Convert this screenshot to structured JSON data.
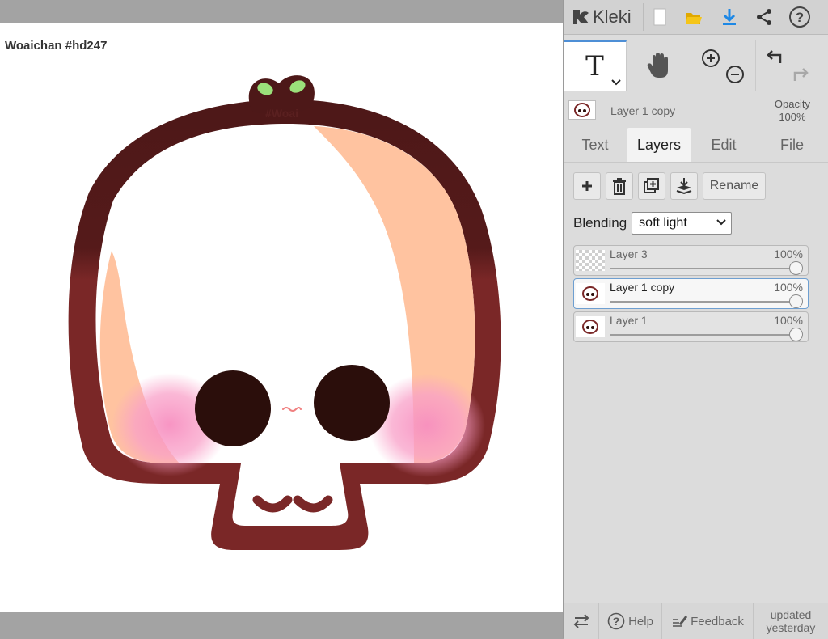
{
  "canvas": {
    "document_title": "Woaichan #hd247",
    "watermark": "#Woai"
  },
  "app": {
    "logo": "Kleki",
    "toolbar_icons": [
      "new-file-icon",
      "open-folder-icon",
      "download-icon",
      "share-icon",
      "help-icon"
    ]
  },
  "tools": {
    "active_tool_glyph": "T",
    "icons": [
      "text-tool-icon",
      "hand-icon",
      "zoom-in-icon",
      "zoom-out-icon",
      "undo-icon",
      "redo-icon"
    ]
  },
  "current_layer": {
    "name": "Layer 1 copy",
    "opacity_label": "Opacity",
    "opacity_value": "100%"
  },
  "tabs": [
    {
      "label": "Text",
      "active": false
    },
    {
      "label": "Layers",
      "active": true
    },
    {
      "label": "Edit",
      "active": false
    },
    {
      "label": "File",
      "active": false
    }
  ],
  "layer_actions": {
    "icons": [
      "add-layer-icon",
      "delete-layer-icon",
      "duplicate-layer-icon",
      "merge-down-icon"
    ],
    "rename_label": "Rename"
  },
  "blending": {
    "label": "Blending",
    "value": "soft light"
  },
  "layers": [
    {
      "name": "Layer 3",
      "opacity": "100%",
      "opacity_fraction": 1.0,
      "selected": false,
      "thumbnail": "empty"
    },
    {
      "name": "Layer 1 copy",
      "opacity": "100%",
      "opacity_fraction": 1.0,
      "selected": true,
      "thumbnail": "character"
    },
    {
      "name": "Layer 1",
      "opacity": "100%",
      "opacity_fraction": 1.0,
      "selected": false,
      "thumbnail": "character"
    }
  ],
  "footer": {
    "help_label": "Help",
    "feedback_label": "Feedback",
    "updated_label": "updated yesterday"
  },
  "colors": {
    "accent_blue": "#1e88e5",
    "folder_yellow": "#f5c518",
    "outline_maroon": "#7a2727",
    "outline_dark": "#4d1818",
    "skin_peach": "#ffc3a0",
    "blush_pink": "#f9a0c8",
    "eye_dark": "#2b0e0b",
    "sprout_green": "#9be07a"
  }
}
